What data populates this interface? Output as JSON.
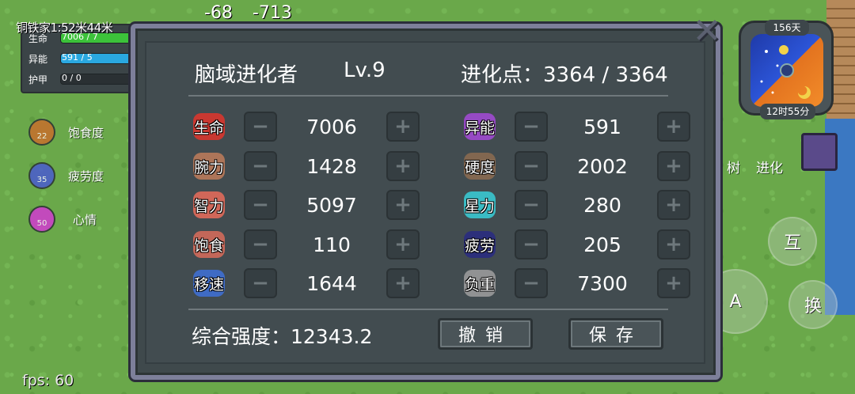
{
  "hud": {
    "name": "铜铁家1:52米44米",
    "coords": "-68  -713",
    "stats": [
      {
        "label": "生命",
        "value": "7006 / 7",
        "color": "#3cc23a",
        "fill": 0.98
      },
      {
        "label": "异能",
        "value": "591 / 5",
        "color": "#2aa8e0",
        "fill": 0.98
      },
      {
        "label": "护甲",
        "value": "0 / 0",
        "color": "#555f63",
        "fill": 0
      }
    ],
    "indicators": [
      {
        "value": "22",
        "label": "饱食度",
        "color": "#c76f2c"
      },
      {
        "value": "35",
        "label": "疲劳度",
        "color": "#4a5bd0"
      },
      {
        "value": "50",
        "label": "心情",
        "color": "#d23ad0"
      }
    ],
    "fps": "fps: 60"
  },
  "clock": {
    "day": "156天",
    "time": "12时55分"
  },
  "side": {
    "tree": "树",
    "evolve": "进化",
    "interact": "互",
    "a": "A",
    "switch": "换"
  },
  "dialog": {
    "name": "脑域进化者",
    "level": "Lv.9",
    "evo_points": "进化点：3364 / 3364",
    "attributes_left": [
      {
        "name": "生命",
        "value": "7006",
        "icon": "heart-icon",
        "color": "#d8362e"
      },
      {
        "name": "腕力",
        "value": "1428",
        "icon": "fist-icon",
        "color": "#b97a5a"
      },
      {
        "name": "智力",
        "value": "5097",
        "icon": "brain-icon",
        "color": "#e06a5a"
      },
      {
        "name": "饱食",
        "value": "110",
        "icon": "meat-icon",
        "color": "#d26a5a"
      },
      {
        "name": "移速",
        "value": "1644",
        "icon": "boot-icon",
        "color": "#3f6fd0"
      }
    ],
    "attributes_right": [
      {
        "name": "异能",
        "value": "591",
        "icon": "star-of-david-icon",
        "color": "#a04ad0"
      },
      {
        "name": "硬度",
        "value": "2002",
        "icon": "shield-icon",
        "color": "#8a6a50"
      },
      {
        "name": "星力",
        "value": "280",
        "icon": "crystal-star-icon",
        "color": "#3ac8d0"
      },
      {
        "name": "疲劳",
        "value": "205",
        "icon": "fatigue-icon",
        "color": "#2a2c80"
      },
      {
        "name": "负重",
        "value": "7300",
        "icon": "weight-icon",
        "color": "#9a9a9a"
      }
    ],
    "total": "综合强度：12343.2",
    "undo": "撤销",
    "save": "保存",
    "minus": "−",
    "plus": "+"
  }
}
